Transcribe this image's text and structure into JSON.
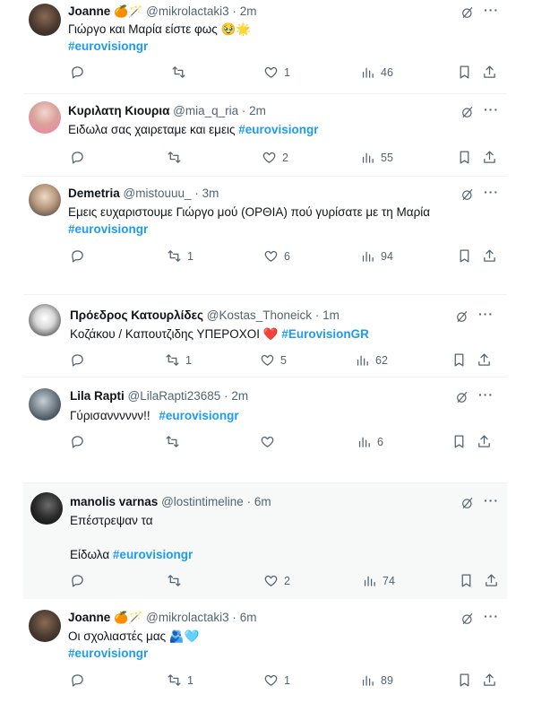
{
  "tweets": [
    {
      "name": "Joanne",
      "emoji": "🍊🪄",
      "handle": "@mikrolactaki3",
      "time": "2m",
      "text": "Γιώργο και Μαρία είστε φως 🥹🌟",
      "hashtag": "#eurovisiongr",
      "replies": "",
      "retweets": "",
      "likes": "1",
      "views": "46"
    },
    {
      "name": "Κυριλατη Κιουρια",
      "handle": "@mia_q_ria",
      "time": "2m",
      "text": "Ειδωλα σας χαιρεταμε και εμεις",
      "hashtag": "#eurovisiongr",
      "replies": "",
      "retweets": "",
      "likes": "2",
      "views": "55"
    },
    {
      "name": "Demetria",
      "handle": "@mistouuu_",
      "time": "3m",
      "text": "Εμεις ευχαριστουμε Γιώργο μού (ΟΡΘΙΑ) πού γυρίσατε με τη Μαρία",
      "hashtag": "#eurovisiongr",
      "replies": "",
      "retweets": "1",
      "likes": "6",
      "views": "94"
    },
    {
      "name": "Πρόεδρος Κατουρλίδες",
      "handle": "@Kostas_Thoneick",
      "time": "1m",
      "text": "Κοζάκου / Καπουτζιδης ΥΠΕΡΟΧΟΙ ❤️",
      "hashtag": "#EurovisionGR",
      "replies": "",
      "retweets": "1",
      "likes": "5",
      "views": "62"
    },
    {
      "name": "Lila Rapti",
      "handle": "@LilaRapti23685",
      "time": "2m",
      "text": "Γύρισανννννν!!",
      "hashtag": "#eurovisiongr",
      "replies": "",
      "retweets": "",
      "likes": "",
      "views": "6"
    },
    {
      "name": "manolis varnas",
      "handle": "@lostintimeline",
      "time": "6m",
      "text": "Επέστρεψαν τα",
      "text2": "Είδωλα",
      "hashtag": "#eurovisiongr",
      "replies": "",
      "retweets": "",
      "likes": "2",
      "views": "74"
    },
    {
      "name": "Joanne",
      "emoji": "🍊🪄",
      "handle": "@mikrolactaki3",
      "time": "6m",
      "text": "Οι σχολιαστές μας 🫂🩵",
      "hashtag": "#eurovisiongr",
      "replies": "",
      "retweets": "1",
      "likes": "1",
      "views": "89"
    }
  ],
  "separator": "·",
  "colors": {
    "accent": "#1d9bf0",
    "muted": "#536471",
    "like": "#536471"
  }
}
